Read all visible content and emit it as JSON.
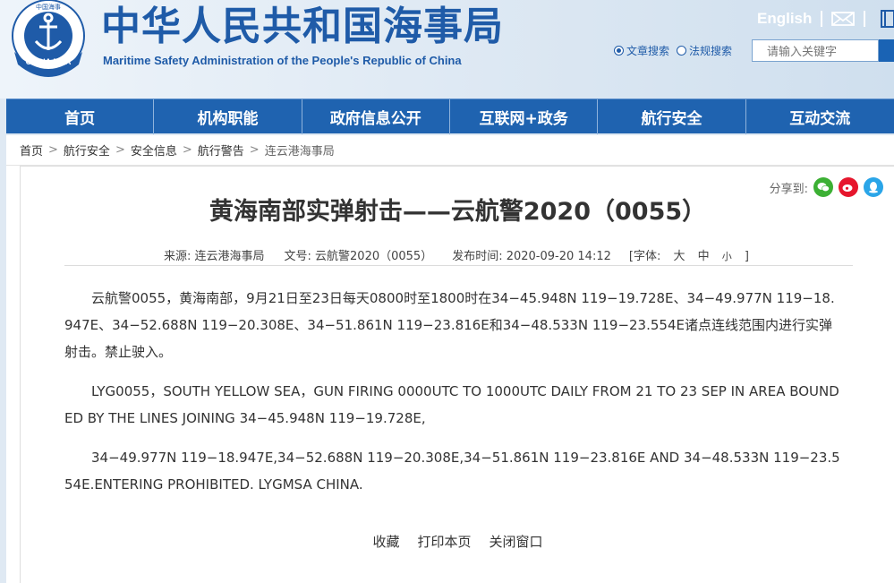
{
  "header": {
    "emblem_text": "CHINA MSA",
    "emblem_top_text": "中国海事",
    "title": "中华人民共和国海事局",
    "subtitle": "Maritime Safety Administration of the People's Republic of China",
    "english_link": "English"
  },
  "search": {
    "radio_article": "文章搜索",
    "radio_law": "法规搜索",
    "selected": "文章搜索",
    "placeholder": "请输入关键字"
  },
  "nav": {
    "items": [
      {
        "label": "首页"
      },
      {
        "label": "机构职能"
      },
      {
        "label": "政府信息公开"
      },
      {
        "label": "互联网+政务"
      },
      {
        "label": "航行安全"
      },
      {
        "label": "互动交流"
      }
    ]
  },
  "breadcrumb": {
    "items": [
      "首页",
      "航行安全",
      "安全信息",
      "航行警告",
      "连云港海事局"
    ],
    "separator": ">"
  },
  "share": {
    "label": "分享到:"
  },
  "article": {
    "title": "黄海南部实弹射击——云航警2020（0055）",
    "source_label": "来源: 连云港海事局",
    "doc_no_label": "文号: 云航警2020（0055）",
    "publish_label": "发布时间: 2020-09-20 14:12",
    "font_label": "[字体:",
    "font_large": "大",
    "font_medium": "中",
    "font_small": "小",
    "font_close": "]",
    "paragraphs": [
      "云航警0055，黄海南部，9月21日至23日每天0800时至1800时在34−45.948N 119−19.728E、34−49.977N 119−18.947E、34−52.688N 119−20.308E、34−51.861N 119−23.816E和34−48.533N 119−23.554E诸点连线范围内进行实弹射击。禁止驶入。",
      "LYG0055，SOUTH YELLOW SEA，GUN FIRING 0000UTC TO 1000UTC DAILY FROM 21 TO 23 SEP IN AREA BOUNDED BY THE LINES JOINING 34−45.948N 119−19.728E,",
      "34−49.977N 119−18.947E,34−52.688N 119−20.308E,34−51.861N 119−23.816E AND 34−48.533N 119−23.554E.ENTERING PROHIBITED. LYGMSA CHINA."
    ]
  },
  "actions": {
    "favorite": "收藏",
    "print": "打印本页",
    "close": "关闭窗口"
  },
  "colors": {
    "brand_blue": "#1f5ba8",
    "nav_blue": "#1f63b0"
  }
}
